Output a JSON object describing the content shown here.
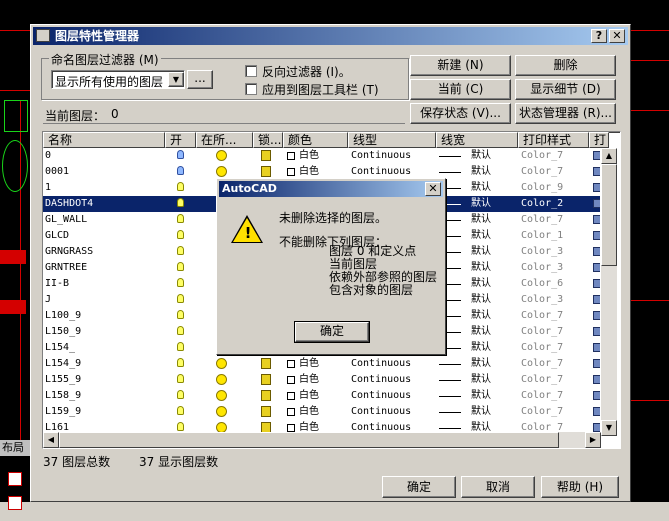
{
  "dialog": {
    "title": "图层特性管理器",
    "filter_group_label": "命名图层过滤器 (M)",
    "filter_select_value": "显示所有使用的图层",
    "filter_more_button": "...",
    "invert_filter_label": "反向过滤器 (I)。",
    "apply_toolbar_label": "应用到图层工具栏 (T)",
    "current_layer_label": "当前图层：",
    "current_layer_value": "0",
    "buttons": {
      "new": "新建 (N)",
      "delete": "删除",
      "current": "当前 (C)",
      "show_details": "显示细节 (D)",
      "save_state": "保存状态 (V)...",
      "state_manager": "状态管理器 (R)..."
    },
    "columns": [
      "名称",
      "开",
      "在所...",
      "锁...",
      "颜色",
      "线型",
      "线宽",
      "打印样式",
      "打"
    ],
    "layers": [
      {
        "name": "0",
        "color": "白色",
        "linetype": "Continuous",
        "lineweight": "默认",
        "plot_style": "Color_7",
        "bulb": "blue"
      },
      {
        "name": "0001",
        "color": "白色",
        "linetype": "Continuous",
        "lineweight": "默认",
        "plot_style": "Color_7",
        "bulb": "blue"
      },
      {
        "name": "1",
        "color": "",
        "linetype": "",
        "lineweight": "默认",
        "plot_style": "Color_9",
        "bulb": "yellow"
      },
      {
        "name": "DASHDOT4",
        "color": "",
        "linetype": "",
        "lineweight": "默认",
        "plot_style": "Color_2",
        "bulb": "yellow"
      },
      {
        "name": "GL_WALL",
        "color": "",
        "linetype": "",
        "lineweight": "默认",
        "plot_style": "Color_7",
        "bulb": "yellow"
      },
      {
        "name": "GLCD",
        "color": "",
        "linetype": "",
        "lineweight": "默认",
        "plot_style": "Color_1",
        "bulb": "yellow"
      },
      {
        "name": "GRNGRASS",
        "color": "",
        "linetype": "",
        "lineweight": "默认",
        "plot_style": "Color_3",
        "bulb": "yellow"
      },
      {
        "name": "GRNTREE",
        "color": "",
        "linetype": "",
        "lineweight": "默认",
        "plot_style": "Color_3",
        "bulb": "yellow"
      },
      {
        "name": "II-B",
        "color": "",
        "linetype": "",
        "lineweight": "默认",
        "plot_style": "Color_6",
        "bulb": "yellow"
      },
      {
        "name": "J",
        "color": "",
        "linetype": "",
        "lineweight": "默认",
        "plot_style": "Color_3",
        "bulb": "yellow"
      },
      {
        "name": "L100_9",
        "color": "",
        "linetype": "",
        "lineweight": "默认",
        "plot_style": "Color_7",
        "bulb": "yellow"
      },
      {
        "name": "L150_9",
        "color": "",
        "linetype": "",
        "lineweight": "默认",
        "plot_style": "Color_7",
        "bulb": "yellow"
      },
      {
        "name": "L154_",
        "color": "",
        "linetype": "",
        "lineweight": "默认",
        "plot_style": "Color_7",
        "bulb": "yellow"
      },
      {
        "name": "L154_9",
        "color": "白色",
        "linetype": "Continuous",
        "lineweight": "默认",
        "plot_style": "Color_7",
        "bulb": "yellow"
      },
      {
        "name": "L155_9",
        "color": "白色",
        "linetype": "Continuous",
        "lineweight": "默认",
        "plot_style": "Color_7",
        "bulb": "yellow"
      },
      {
        "name": "L158_9",
        "color": "白色",
        "linetype": "Continuous",
        "lineweight": "默认",
        "plot_style": "Color_7",
        "bulb": "yellow"
      },
      {
        "name": "L159_9",
        "color": "白色",
        "linetype": "Continuous",
        "lineweight": "默认",
        "plot_style": "Color_7",
        "bulb": "yellow"
      },
      {
        "name": "L161",
        "color": "白色",
        "linetype": "Continuous",
        "lineweight": "默认",
        "plot_style": "Color_7",
        "bulb": "yellow"
      }
    ],
    "selected_index": 3,
    "status_total": "37 图层总数",
    "status_shown": "37 显示图层数",
    "ok": "确定",
    "cancel": "取消",
    "help": "帮助 (H)"
  },
  "alert": {
    "title": "AutoCAD",
    "close": "✕",
    "message": "未删除选择的图层。",
    "reason": "不能删除下列图层：",
    "items": [
      "图层 0 和定义点",
      "当前图层",
      "依赖外部参照的图层",
      "包含对象的图层"
    ],
    "ok": "确定"
  },
  "background": {
    "layout_tab": "布局"
  },
  "colors": {
    "accent": "#0a246a",
    "face": "#d4d0c8"
  }
}
